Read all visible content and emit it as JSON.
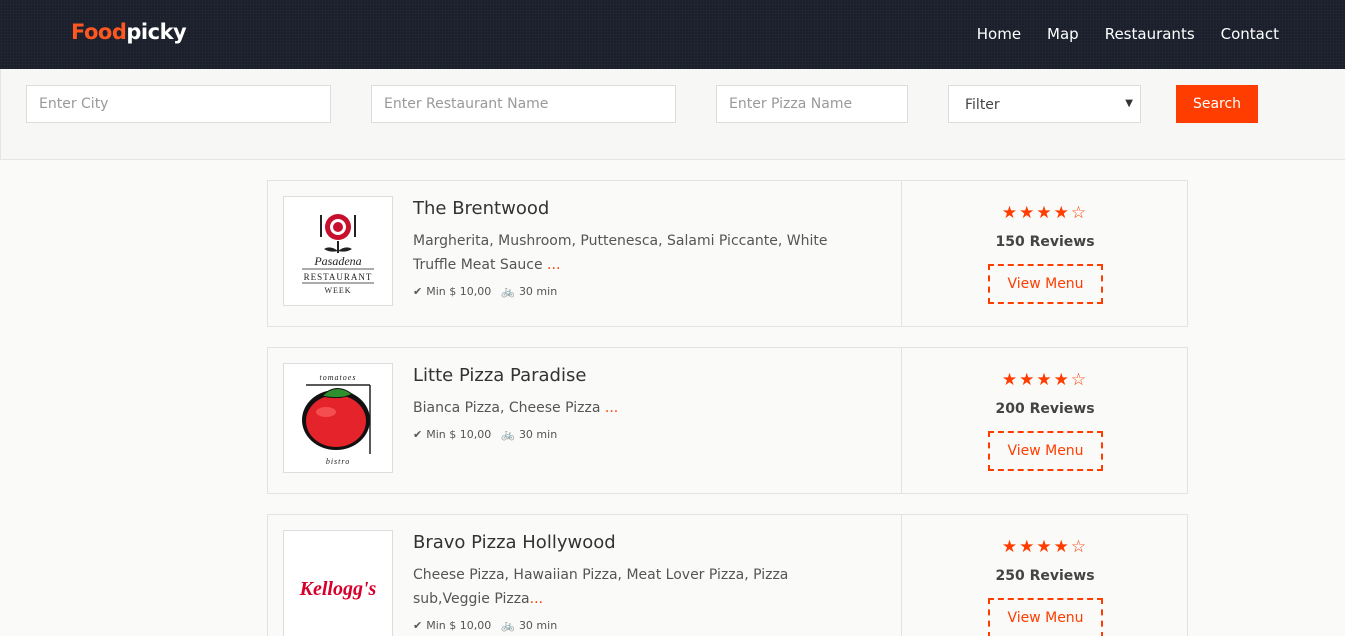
{
  "header": {
    "logo_part1": "Food",
    "logo_part2": "picky",
    "nav": [
      "Home",
      "Map",
      "Restaurants",
      "Contact"
    ]
  },
  "search": {
    "city_placeholder": "Enter City",
    "restaurant_placeholder": "Enter Restaurant Name",
    "pizza_placeholder": "Enter Pizza Name",
    "filter_label": "Filter",
    "button_label": "Search"
  },
  "restaurants": [
    {
      "name": "The Brentwood",
      "description": "Margherita, Mushroom, Puttenesca, Salami Piccante, White Truffle Meat Sauce",
      "more": "...",
      "min_order": "Min $ 10,00",
      "delivery_time": "30 min",
      "reviews": "150 Reviews",
      "rating": 4,
      "button": "View Menu",
      "logo": {
        "line1": "Pasadena",
        "line2": "RESTAURANT",
        "line3": "WEEK"
      }
    },
    {
      "name": "Litte Pizza Paradise",
      "description": "Bianca Pizza, Cheese Pizza",
      "more": "...",
      "min_order": "Min $ 10,00",
      "delivery_time": "30 min",
      "reviews": "200 Reviews",
      "rating": 4,
      "button": "View Menu",
      "logo": {
        "top": "tomatoes",
        "bottom": "bistro"
      }
    },
    {
      "name": "Bravo Pizza Hollywood",
      "description": "Cheese Pizza, Hawaiian Pizza, Meat Lover Pizza, Pizza sub,Veggie Pizza",
      "more": "...",
      "min_order": "Min $ 10,00",
      "delivery_time": "30 min",
      "reviews": "250 Reviews",
      "rating": 4,
      "button": "View Menu",
      "logo": {
        "text": "Kellogg's"
      }
    }
  ],
  "colors": {
    "accent": "#ff3d00",
    "header_bg": "#1a1f2b",
    "logo_orange": "#ff5722"
  },
  "icons": {
    "min_order": "check-icon",
    "delivery": "motorbike-icon",
    "rating": "star-icon",
    "filter": "caret-down-icon"
  }
}
